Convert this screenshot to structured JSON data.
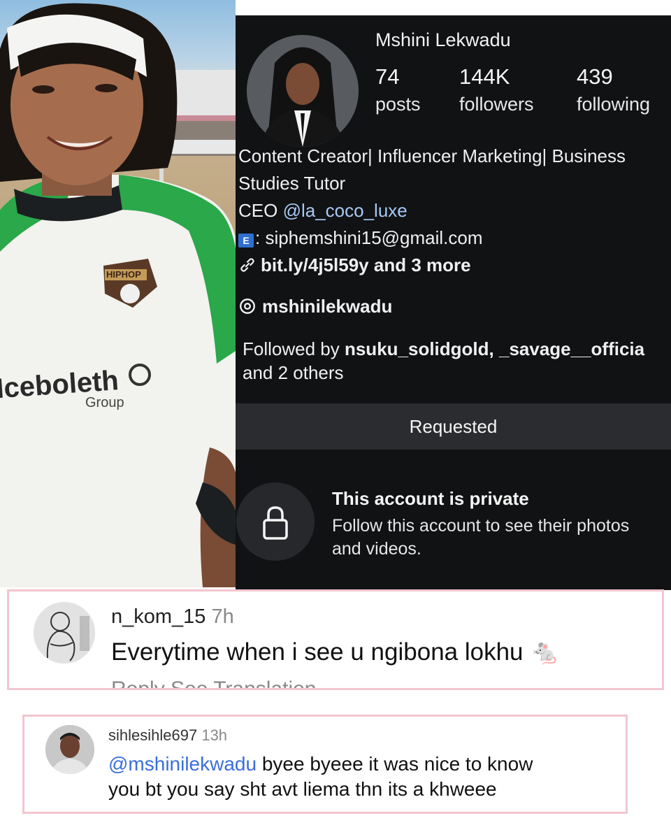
{
  "photo": {
    "jersey_badge": "HIPHOP",
    "jersey_sponsor": "Iceboleth",
    "jersey_sponsor_sub": "Group"
  },
  "profile": {
    "name": "Mshini Lekwadu",
    "stats": [
      {
        "value": "74",
        "label": "posts"
      },
      {
        "value": "144K",
        "label": "followers"
      },
      {
        "value": "439",
        "label": "following"
      }
    ],
    "bio_line1": "Content Creator| Influencer Marketing| Business",
    "bio_line2": "Studies Tutor",
    "ceo_prefix": "CEO ",
    "ceo_handle": "@la_coco_luxe",
    "email_icon": "E",
    "email": ": siphemshini15@gmail.com",
    "link": "bit.ly/4j5l59y and 3 more",
    "threads_handle": "mshinilekwadu",
    "followed_by_prefix": "Followed by ",
    "followed_by_users": "nsuku_solidgold, _savage__officia",
    "followed_by_suffix": "and 2 others",
    "requested_button": "Requested",
    "private_title": "This account is private",
    "private_desc_line1": "Follow this account to see their photos",
    "private_desc_line2": "and videos.",
    "icons": [
      "link-icon",
      "threads-icon",
      "lock-icon",
      "email-icon"
    ]
  },
  "comment1": {
    "username": "n_kom_15",
    "time": "7h",
    "text": "Everytime when i see u ngibona lokhu",
    "emoji": "🐁",
    "actions": "Reply     See Translation"
  },
  "comment2": {
    "username": "sihlesihle697",
    "time": "13h",
    "mention": "@mshinilekwadu",
    "text_line1_rest": " byee byeee it was nice to know",
    "text_line2": "you bt you say sht avt liema thn its a khweee"
  },
  "colors": {
    "profile_bg": "#101214",
    "link_blue": "#a9c9f5",
    "mention_blue": "#3b6fd8",
    "highlight_border": "#f2c6cf"
  }
}
